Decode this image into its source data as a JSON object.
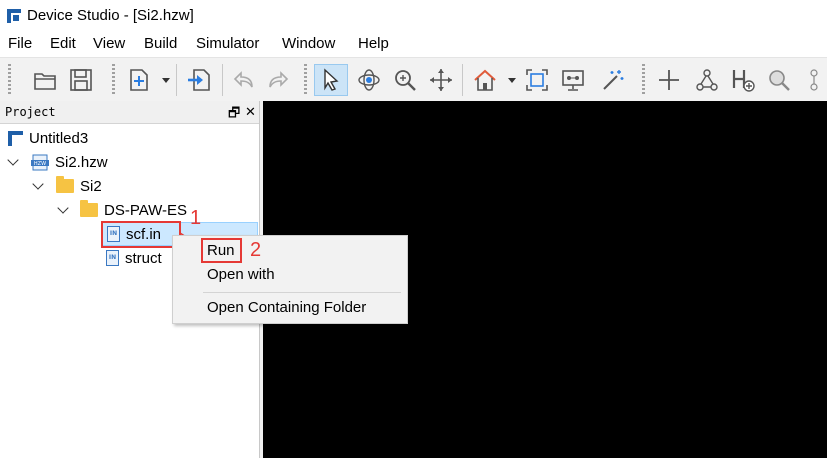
{
  "window": {
    "title": "Device Studio - [Si2.hzw]"
  },
  "menu": [
    "File",
    "Edit",
    "View",
    "Build",
    "Simulator",
    "Window",
    "Help"
  ],
  "toolbar": {
    "icons": [
      "open-folder-icon",
      "save-icon",
      "new-file-icon",
      "import-icon",
      "undo-icon",
      "redo-icon",
      "select-pointer-icon",
      "rotate-icon",
      "zoom-icon",
      "move-icon",
      "home-icon",
      "fit-view-icon",
      "network-view-icon",
      "magic-wand-icon",
      "add-atom-icon",
      "molecule-icon",
      "add-hydrogen-icon",
      "search-atom-icon",
      "atom-label-icon"
    ]
  },
  "panel": {
    "title": "Project",
    "float_icon": "🗗",
    "close_icon": "✕"
  },
  "tree": {
    "project": "Untitled3",
    "file": "Si2.hzw",
    "folder1": "Si2",
    "folder2": "DS-PAW-ES",
    "item1": "scf.in",
    "item2": "structure.as",
    "item2_visible": "struct",
    "file_icon_text": "IN",
    "hzw_icon_text": "HZW"
  },
  "context_menu": {
    "run": "Run",
    "open_with": "Open with",
    "open_containing_folder": "Open Containing Folder"
  },
  "annotations": {
    "step1": "1",
    "step2": "2",
    "color": "#e53935"
  }
}
